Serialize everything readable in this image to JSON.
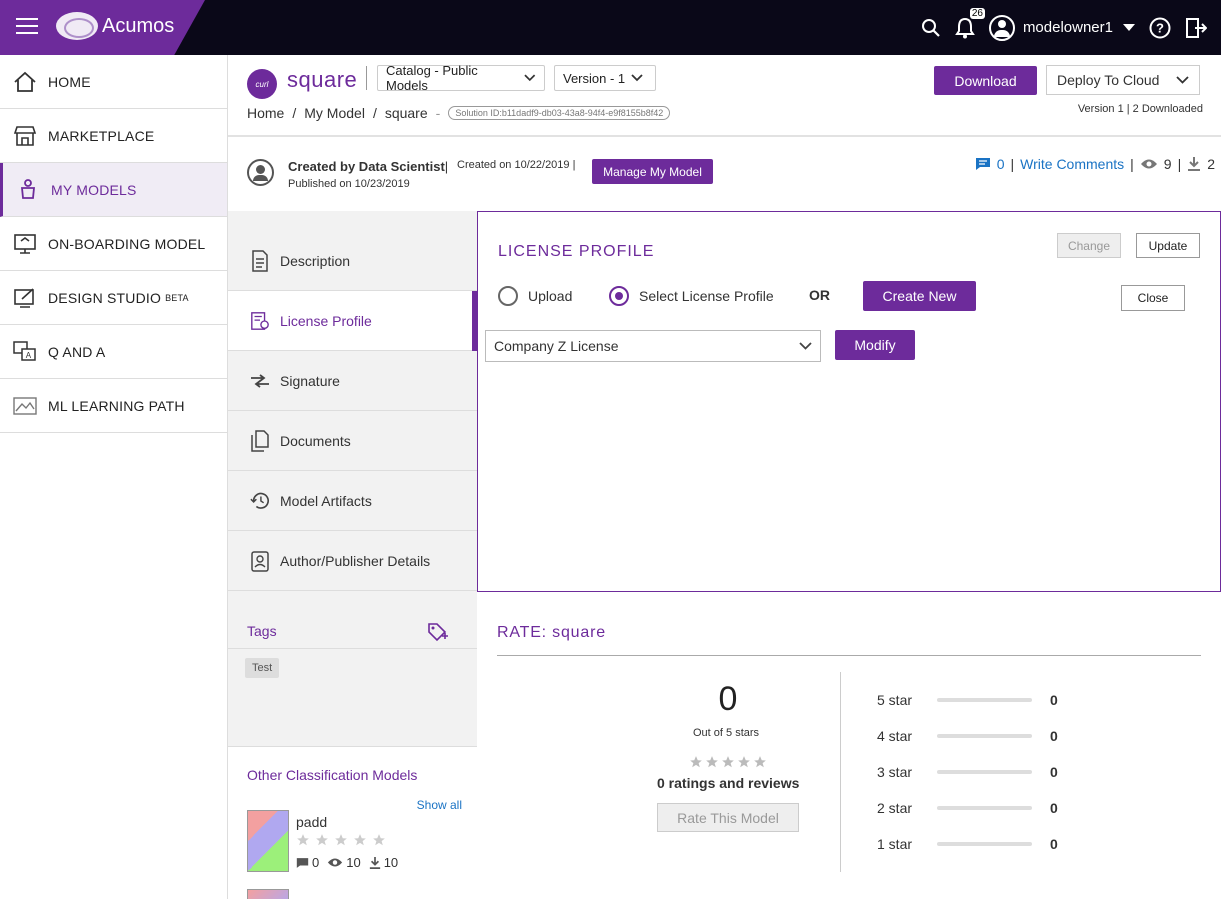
{
  "topbar": {
    "brand": "Acumos",
    "notification_count": "26",
    "username": "modelowner1"
  },
  "sidebar": {
    "items": [
      {
        "label": "HOME",
        "icon": "home-icon"
      },
      {
        "label": "MARKETPLACE",
        "icon": "store-icon"
      },
      {
        "label": "MY MODELS",
        "icon": "my-models-icon"
      },
      {
        "label": "ON-BOARDING MODEL",
        "icon": "onboarding-icon"
      },
      {
        "label": "DESIGN STUDIO",
        "sup": "BETA",
        "icon": "design-studio-icon"
      },
      {
        "label": "Q AND A",
        "icon": "qa-icon"
      },
      {
        "label": "ML LEARNING PATH",
        "icon": "learning-path-icon"
      }
    ]
  },
  "header": {
    "logo_text": "curl",
    "model_name": "square",
    "catalog": "Catalog - Public Models",
    "version": "Version - 1",
    "download_label": "Download",
    "deploy_label": "Deploy To Cloud",
    "version_meta": "Version 1 | 2 Downloaded",
    "breadcrumb": {
      "home": "Home",
      "my_model": "My Model",
      "current": "square"
    },
    "solution_id": "Solution ID:b11dadf9-db03-43a8-94f4-e9f8155b8f42"
  },
  "info": {
    "created_by": "Created by Data Scientist",
    "created_on": "Created on 10/22/2019",
    "published_on": "Published on 10/23/2019",
    "manage_label": "Manage My Model",
    "comments_count": "0",
    "write_comments": "Write Comments",
    "views": "9",
    "downloads": "2"
  },
  "tabs": {
    "items": [
      {
        "label": "Description",
        "icon": "description-icon"
      },
      {
        "label": "License Profile",
        "icon": "license-icon"
      },
      {
        "label": "Signature",
        "icon": "signature-icon"
      },
      {
        "label": "Documents",
        "icon": "documents-icon"
      },
      {
        "label": "Model Artifacts",
        "icon": "history-icon"
      },
      {
        "label": "Author/Publisher Details",
        "icon": "author-icon"
      }
    ],
    "tags_title": "Tags",
    "tag": "Test",
    "other_title": "Other Classification Models",
    "show_all": "Show all",
    "other_model": {
      "name": "padd",
      "comments": "0",
      "views": "10",
      "downloads": "10"
    }
  },
  "license": {
    "title": "LICENSE PROFILE",
    "change": "Change",
    "update": "Update",
    "upload": "Upload",
    "select_profile": "Select License Profile",
    "or": "OR",
    "create_new": "Create New",
    "close": "Close",
    "selected_license": "Company Z License",
    "modify": "Modify"
  },
  "rating": {
    "title": "RATE: square",
    "average": "0",
    "out_of": "Out of 5 stars",
    "ratings_reviews": "0 ratings and reviews",
    "rate_button": "Rate This Model",
    "rows": [
      {
        "label": "5 star",
        "count": "0"
      },
      {
        "label": "4 star",
        "count": "0"
      },
      {
        "label": "3 star",
        "count": "0"
      },
      {
        "label": "2 star",
        "count": "0"
      },
      {
        "label": "1 star",
        "count": "0"
      }
    ]
  },
  "colors": {
    "accent": "#6d2b9b",
    "topbar": "#0a0818",
    "link": "#1a73c4"
  }
}
